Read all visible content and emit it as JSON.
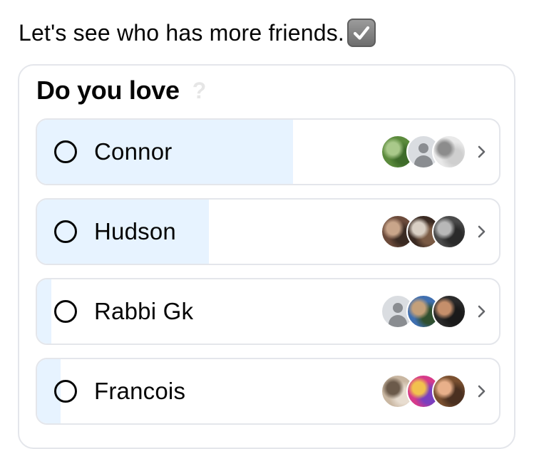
{
  "caption": {
    "text": "Let's see who has more friends.",
    "emoji_icon": "check-mark-button-icon"
  },
  "poll": {
    "question": "Do you love",
    "help_icon": "question-mark-icon",
    "colors": {
      "fill": "#e7f3ff",
      "border": "#e4e6eb",
      "text": "#050505"
    },
    "options": [
      {
        "label": "Connor",
        "vote_share": 0.55,
        "avatars": [
          {
            "type": "photo",
            "colors": [
              "#5b8a3c",
              "#a9c98a",
              "#3e6b2a"
            ]
          },
          {
            "type": "placeholder"
          },
          {
            "type": "photo",
            "colors": [
              "#e9e9e9",
              "#8c8c8c",
              "#cfcfcf"
            ]
          }
        ]
      },
      {
        "label": "Hudson",
        "vote_share": 0.37,
        "avatars": [
          {
            "type": "photo",
            "colors": [
              "#6b4a3a",
              "#c9a58a",
              "#3a2a22"
            ]
          },
          {
            "type": "photo",
            "colors": [
              "#3a2a22",
              "#d9cfc4",
              "#7a5a44"
            ]
          },
          {
            "type": "photo",
            "colors": [
              "#4a4a4a",
              "#b8b8b8",
              "#2a2a2a"
            ]
          }
        ]
      },
      {
        "label": "Rabbi Gk",
        "vote_share": 0.03,
        "avatars": [
          {
            "type": "placeholder"
          },
          {
            "type": "photo",
            "colors": [
              "#3f6fb0",
              "#c4a07a",
              "#2f4f2f"
            ]
          },
          {
            "type": "photo",
            "colors": [
              "#2a2a2a",
              "#c58f6b",
              "#1a1a1a"
            ]
          }
        ]
      },
      {
        "label": "Francois",
        "vote_share": 0.05,
        "avatars": [
          {
            "type": "photo",
            "colors": [
              "#c9b7a2",
              "#6b5a4a",
              "#e8ddd0"
            ]
          },
          {
            "type": "photo",
            "colors": [
              "#d63a8a",
              "#f2c14e",
              "#7a3fbf"
            ]
          },
          {
            "type": "photo",
            "colors": [
              "#7a5030",
              "#e8b08a",
              "#4a3020"
            ]
          }
        ]
      }
    ]
  }
}
